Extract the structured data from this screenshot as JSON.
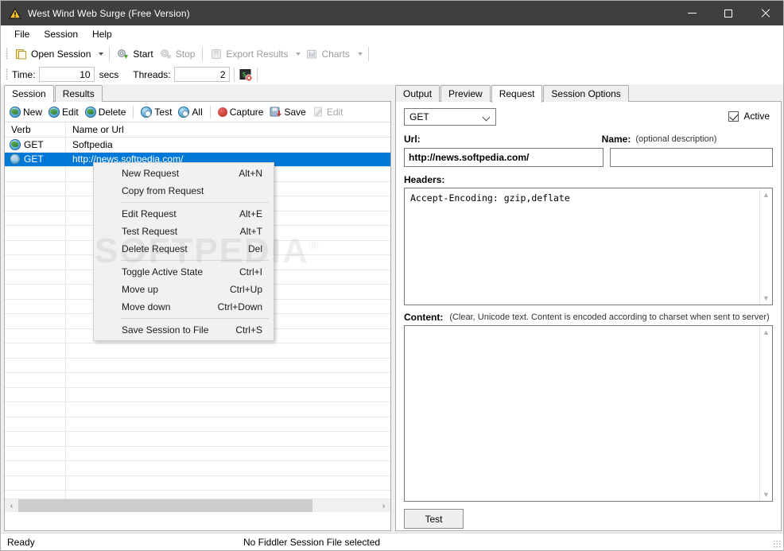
{
  "window": {
    "title": "West Wind Web Surge (Free Version)",
    "icon": "app-triangle-icon",
    "controls": {
      "minimize": "minimize",
      "maximize": "maximize",
      "close": "close"
    }
  },
  "menubar": {
    "items": [
      "File",
      "Session",
      "Help"
    ]
  },
  "toolbar": {
    "open_session": "Open Session",
    "start": "Start",
    "stop": "Stop",
    "export_results": "Export Results",
    "charts": "Charts"
  },
  "params": {
    "time_label": "Time:",
    "time_value": "10",
    "secs_label": "secs",
    "threads_label": "Threads:",
    "threads_value": "2"
  },
  "left_pane": {
    "tabs": [
      {
        "label": "Session",
        "active": true
      },
      {
        "label": "Results",
        "active": false
      }
    ],
    "toolbar": [
      {
        "label": "New",
        "icon": "globe-new-icon",
        "enabled": true
      },
      {
        "label": "Edit",
        "icon": "globe-edit-icon",
        "enabled": true
      },
      {
        "label": "Delete",
        "icon": "globe-delete-icon",
        "enabled": true
      },
      {
        "label": "Test",
        "icon": "globe-test-icon",
        "enabled": true
      },
      {
        "label": "All",
        "icon": "globe-all-icon",
        "enabled": true
      },
      {
        "label": "Capture",
        "icon": "record-circle-icon",
        "enabled": true
      },
      {
        "label": "Save",
        "icon": "save-disk-icon",
        "enabled": true
      },
      {
        "label": "Edit",
        "icon": "edit-page-icon",
        "enabled": false
      }
    ],
    "grid": {
      "columns": [
        "Verb",
        "Name or Url"
      ],
      "rows": [
        {
          "verb": "GET",
          "name": "Softpedia",
          "selected": false
        },
        {
          "verb": "GET",
          "name": "http://news.softpedia.com/",
          "selected": true
        }
      ],
      "empty_rows": 23
    },
    "hscrollbar": {
      "left_arrow": "‹",
      "right_arrow": "›"
    }
  },
  "context_menu": {
    "groups": [
      [
        {
          "label": "New Request",
          "accel": "Alt+N"
        },
        {
          "label": "Copy from Request",
          "accel": ""
        }
      ],
      [
        {
          "label": "Edit Request",
          "accel": "Alt+E"
        },
        {
          "label": "Test Request",
          "accel": "Alt+T"
        },
        {
          "label": "Delete Request",
          "accel": "Del"
        }
      ],
      [
        {
          "label": "Toggle Active State",
          "accel": "Ctrl+I"
        },
        {
          "label": "Move up",
          "accel": "Ctrl+Up"
        },
        {
          "label": "Move down",
          "accel": "Ctrl+Down"
        }
      ],
      [
        {
          "label": "Save Session to File",
          "accel": "Ctrl+S"
        }
      ]
    ]
  },
  "right_pane": {
    "tabs": [
      {
        "label": "Output",
        "active": false
      },
      {
        "label": "Preview",
        "active": false
      },
      {
        "label": "Request",
        "active": true
      },
      {
        "label": "Session Options",
        "active": false
      }
    ],
    "verb_select": {
      "value": "GET"
    },
    "active_checkbox": {
      "label": "Active",
      "checked": true
    },
    "url": {
      "label": "Url:",
      "value": "http://news.softpedia.com/"
    },
    "name": {
      "label": "Name:",
      "hint": "(optional description)",
      "value": "",
      "placeholder": ""
    },
    "headers": {
      "label": "Headers:",
      "value": "Accept-Encoding: gzip,deflate"
    },
    "content": {
      "label": "Content:",
      "hint": "(Clear, Unicode text. Content is encoded according to charset when sent to server)",
      "value": ""
    },
    "test_button": "Test"
  },
  "statusbar": {
    "left": "Ready",
    "middle": "No Fiddler Session File selected"
  },
  "watermark": "SOFTPEDIA",
  "colors": {
    "titlebar": "#3f3f3f",
    "selection": "#0078d7",
    "window_bg": "#f0f0f0",
    "border": "#acacac"
  }
}
